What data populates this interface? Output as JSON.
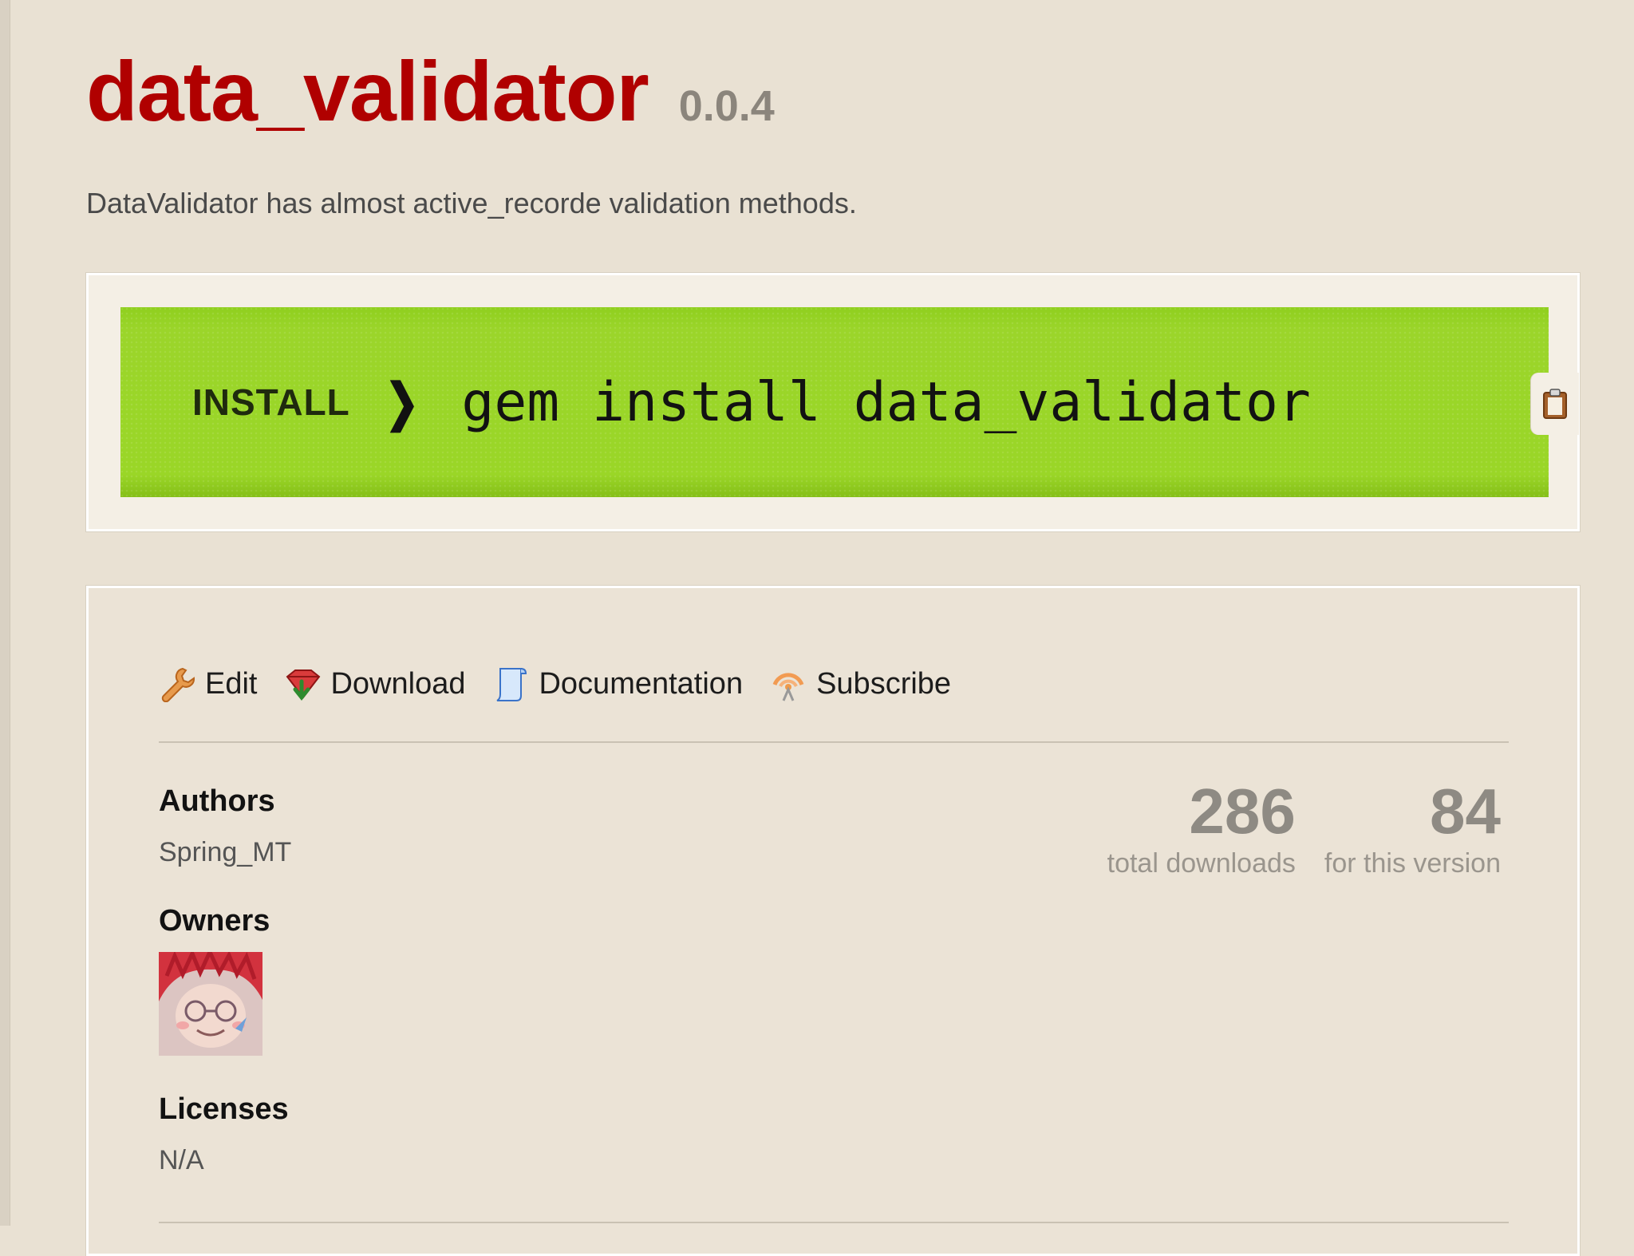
{
  "gem": {
    "name": "data_validator",
    "version": "0.0.4",
    "description": "DataValidator has almost active_recorde validation methods."
  },
  "install": {
    "label": "INSTALL",
    "chevron": "❯",
    "command": "gem install data_validator",
    "copy_icon": "clipboard-icon"
  },
  "links": [
    {
      "label": "Edit",
      "icon": "wrench-icon"
    },
    {
      "label": "Download",
      "icon": "download-gem-icon"
    },
    {
      "label": "Documentation",
      "icon": "document-icon"
    },
    {
      "label": "Subscribe",
      "icon": "rss-feed-icon"
    }
  ],
  "authors": {
    "heading": "Authors",
    "value": "Spring_MT"
  },
  "owners": {
    "heading": "Owners",
    "avatar": "owner-avatar"
  },
  "licenses": {
    "heading": "Licenses",
    "value": "N/A"
  },
  "stats": {
    "total_downloads": "286",
    "total_downloads_label": "total downloads",
    "version_downloads": "84",
    "version_downloads_label": "for this version"
  },
  "colors": {
    "title": "#b00000",
    "install_bar": "#9ad627",
    "background": "#e9e1d3"
  }
}
